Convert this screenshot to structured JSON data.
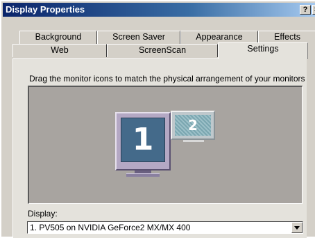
{
  "window": {
    "title": "Display Properties",
    "help_glyph": "?",
    "close_glyph": "×"
  },
  "tabs": {
    "back_row": [
      "Background",
      "Screen Saver",
      "Appearance",
      "Effects"
    ],
    "front_row": [
      "Web",
      "ScreenScan",
      "Settings"
    ],
    "selected": "Settings"
  },
  "settings": {
    "instruction": "Drag the monitor icons to match the physical arrangement of your monitors",
    "monitors": [
      {
        "number": "1",
        "state": "primary"
      },
      {
        "number": "2",
        "state": "inactive"
      }
    ],
    "display_label": "Display:",
    "display_value": "1. PV505 on NVIDIA GeForce2 MX/MX 400",
    "dropdown_icon": "chevron-down-icon"
  },
  "colors": {
    "titlebar_start": "#0a246a",
    "titlebar_end": "#a6caf0",
    "monitor1_screen": "#446a8a",
    "monitor2_screen": "#7aa6b0",
    "monitor_frame": "#b4a8c4"
  }
}
